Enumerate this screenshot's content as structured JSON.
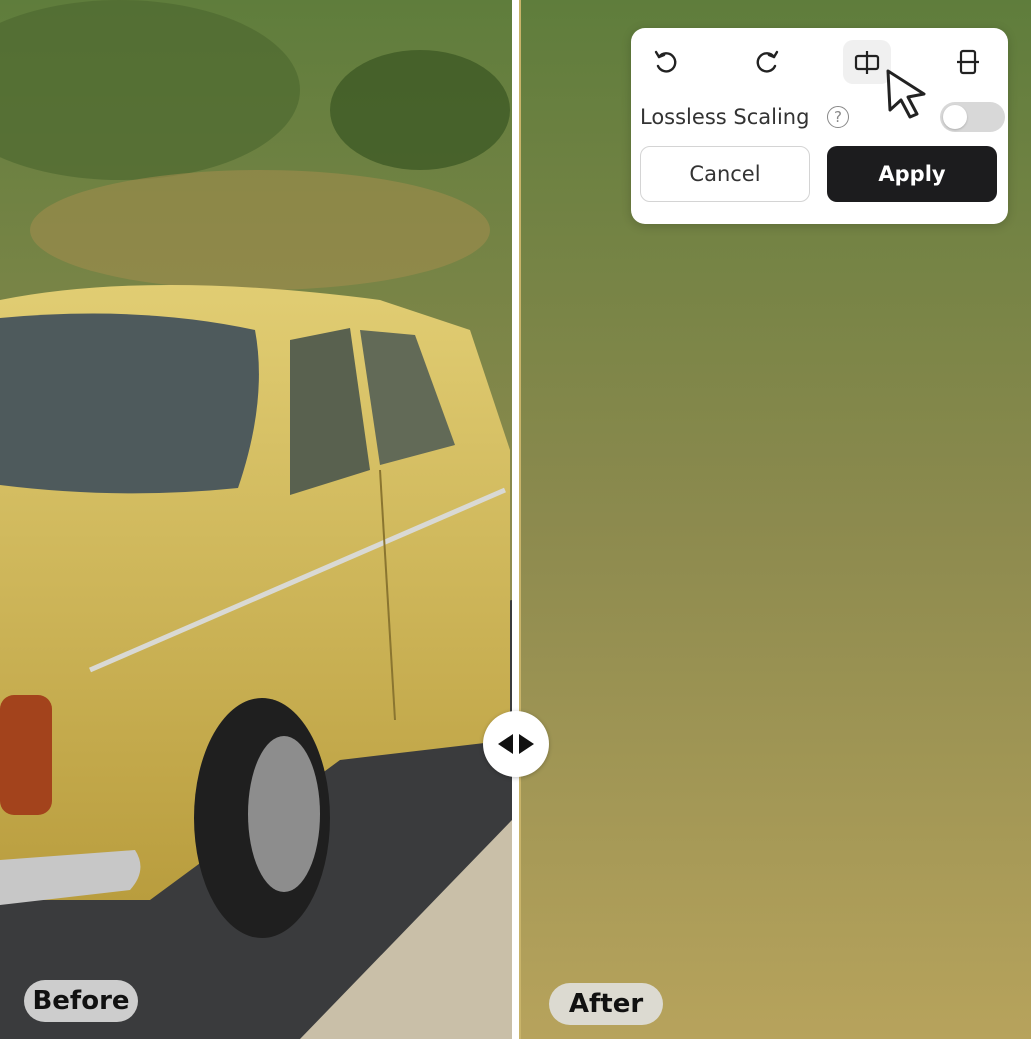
{
  "comparison": {
    "before_label": "Before",
    "after_label": "After"
  },
  "panel": {
    "tools": [
      {
        "name": "rotate-left-icon"
      },
      {
        "name": "rotate-right-icon"
      },
      {
        "name": "flip-horizontal-icon",
        "active": true
      },
      {
        "name": "flip-vertical-icon"
      }
    ],
    "lossless_label": "Lossless Scaling",
    "help_glyph": "?",
    "lossless_enabled": false,
    "cancel_label": "Cancel",
    "apply_label": "Apply"
  },
  "colors": {
    "apply_bg": "#1c1c1e",
    "car_body": "#d3bc5c",
    "road": "#3a3b3d"
  }
}
